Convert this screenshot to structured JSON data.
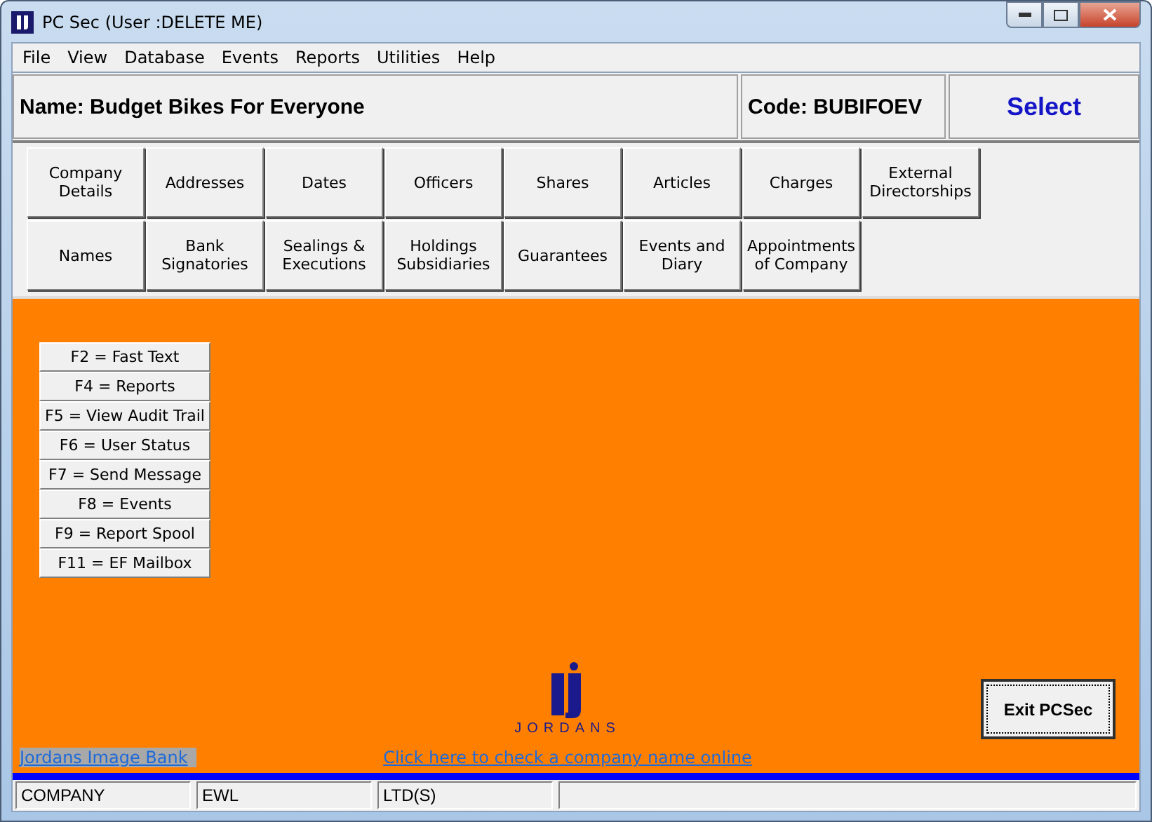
{
  "window": {
    "title": "PC Sec (User :DELETE ME)"
  },
  "menu": [
    "File",
    "View",
    "Database",
    "Events",
    "Reports",
    "Utilities",
    "Help"
  ],
  "header": {
    "name": "Name: Budget Bikes For Everyone",
    "code": "Code: BUBIFOEV",
    "select_button": "Select"
  },
  "nav_buttons": [
    [
      "Company Details",
      "Addresses",
      "Dates",
      "Officers",
      "Shares",
      "Articles",
      "Charges",
      "External Directorships"
    ],
    [
      "Names",
      "Bank Signatories",
      "Sealings & Executions",
      "Holdings Subsidiaries",
      "Guarantees",
      "Events and Diary",
      "Appointments of Company"
    ]
  ],
  "function_keys": [
    "F2 = Fast Text",
    "F4 = Reports",
    "F5 = View Audit Trail",
    "F6 = User Status",
    "F7 = Send Message",
    "F8 = Events",
    "F9 = Report Spool",
    "F11 = EF Mailbox"
  ],
  "logo": {
    "text": "JORDANS"
  },
  "links": {
    "image_bank": "Jordans Image Bank",
    "check_name": "Click here to check a company name online"
  },
  "exit_button": "Exit PCSec",
  "status_bar": [
    "COMPANY",
    "EWL",
    "LTD(S)"
  ]
}
